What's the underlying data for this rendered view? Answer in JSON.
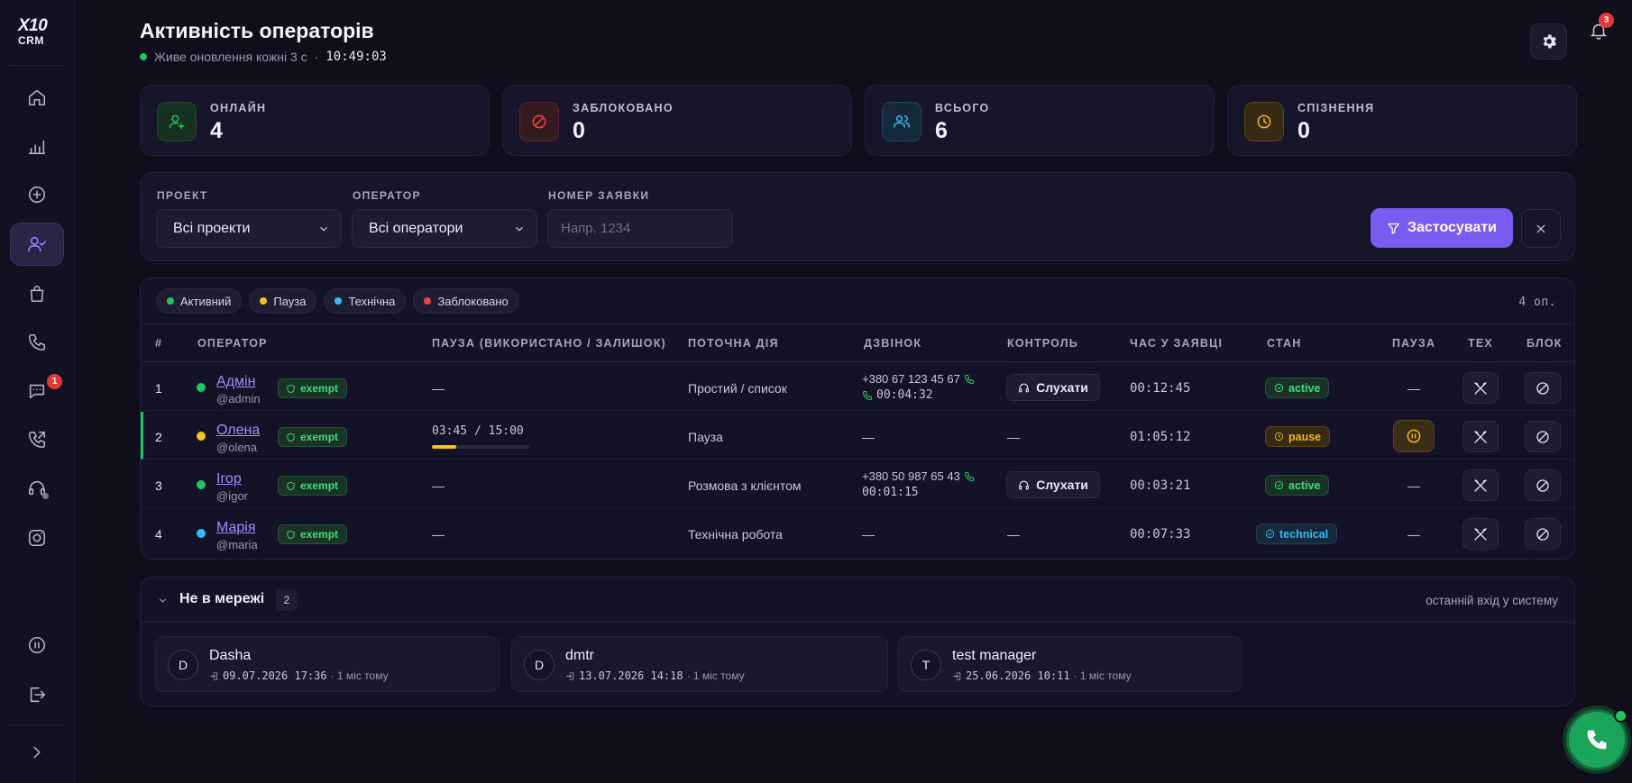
{
  "app": {
    "logo_top": "X10",
    "logo_bottom": "CRM"
  },
  "header": {
    "title": "Активність операторів",
    "live_text": "Живе оновлення кожні 3 с",
    "separator": "·",
    "time": "10:49:03",
    "notifications_count": "3"
  },
  "sidebar": {
    "items": [
      {
        "icon": "home-icon"
      },
      {
        "icon": "bar-chart-icon"
      },
      {
        "icon": "plus-circle-icon"
      },
      {
        "icon": "user-check-icon",
        "active": true
      },
      {
        "icon": "shopping-bag-icon"
      },
      {
        "icon": "phone-icon"
      },
      {
        "icon": "chat-icon",
        "badge": "1"
      },
      {
        "icon": "phone-outgoing-icon"
      },
      {
        "icon": "headset-icon"
      },
      {
        "icon": "instagram-icon"
      },
      {
        "icon": "pause-circle-icon"
      },
      {
        "icon": "logout-icon"
      },
      {
        "icon": "chevron-right-icon"
      }
    ]
  },
  "stats": [
    {
      "label": "ОНЛАЙН",
      "value": "4",
      "color": "#22c55e",
      "icon": "user-plus-icon"
    },
    {
      "label": "ЗАБЛОКОВАНО",
      "value": "0",
      "color": "#ef4444",
      "icon": "ban-icon"
    },
    {
      "label": "ВСЬОГО",
      "value": "6",
      "color": "#38bdf8",
      "icon": "users-icon"
    },
    {
      "label": "СПІЗНЕННЯ",
      "value": "0",
      "color": "#f5b51f",
      "icon": "clock-icon"
    }
  ],
  "filters": {
    "project_label": "ПРОЕКТ",
    "project_value": "Всі проекти",
    "operator_label": "ОПЕРАТОР",
    "operator_value": "Всі оператори",
    "ticket_label": "НОМЕР ЗАЯВКИ",
    "ticket_placeholder": "Напр. 1234",
    "apply_label": "Застосувати"
  },
  "legend": [
    {
      "label": "Активний",
      "color": "#22c55e"
    },
    {
      "label": "Пауза",
      "color": "#f5c518"
    },
    {
      "label": "Технічна",
      "color": "#38bdf8"
    },
    {
      "label": "Заблоковано",
      "color": "#ef4444"
    }
  ],
  "operators_count": "4 оп.",
  "columns": [
    "#",
    "ОПЕРАТОР",
    "ПАУЗА (ВИКОРИСТАНО / ЗАЛИШОК)",
    "ПОТОЧНА ДІЯ",
    "ДЗВІНОК",
    "КОНТРОЛЬ",
    "ЧАС У ЗАЯВЦІ",
    "СТАН",
    "ПАУЗА",
    "ТЕХ",
    "БЛОК"
  ],
  "rows": [
    {
      "num": "1",
      "name": "Адмін",
      "user": "@admin",
      "status_color": "#22c55e",
      "exempt": "exempt",
      "pause": "—",
      "action": "Простий / список",
      "phone": "+380 67 123 45 67",
      "call_time": "00:04:32",
      "control": "Слухати",
      "time": "00:12:45",
      "state": "active",
      "pause_col": "—"
    },
    {
      "num": "2",
      "name": "Олена",
      "user": "@olena",
      "status_color": "#f5c518",
      "exempt": "exempt",
      "pause": "03:45 / 15:00",
      "pause_progress": 0.25,
      "action": "Пауза",
      "phone": "—",
      "call_time": "",
      "control": "—",
      "time": "01:05:12",
      "state": "pause",
      "pause_col": ""
    },
    {
      "num": "3",
      "name": "Ігор",
      "user": "@igor",
      "status_color": "#22c55e",
      "exempt": "exempt",
      "pause": "—",
      "action": "Розмова з клієнтом",
      "phone": "+380 50 987 65 43",
      "call_time": "00:01:15",
      "control": "Слухати",
      "time": "00:03:21",
      "state": "active",
      "pause_col": "—"
    },
    {
      "num": "4",
      "name": "Марія",
      "user": "@maria",
      "status_color": "#38bdf8",
      "exempt": "exempt",
      "pause": "—",
      "action": "Технічна робота",
      "phone": "—",
      "call_time": "",
      "control": "—",
      "time": "00:07:33",
      "state": "technical",
      "pause_col": "—"
    }
  ],
  "offline": {
    "title": "Не в мережі",
    "count": "2",
    "hint": "останній вхід у систему",
    "users": [
      {
        "initial": "D",
        "name": "Dasha",
        "login": "09.07.2026 17:36",
        "ago": "· 1 міс тому"
      },
      {
        "initial": "D",
        "name": "dmtr",
        "login": "13.07.2026 14:18",
        "ago": "· 1 міс тому"
      },
      {
        "initial": "T",
        "name": "test manager",
        "login": "25.06.2026 10:11",
        "ago": "· 1 міс тому"
      }
    ]
  }
}
